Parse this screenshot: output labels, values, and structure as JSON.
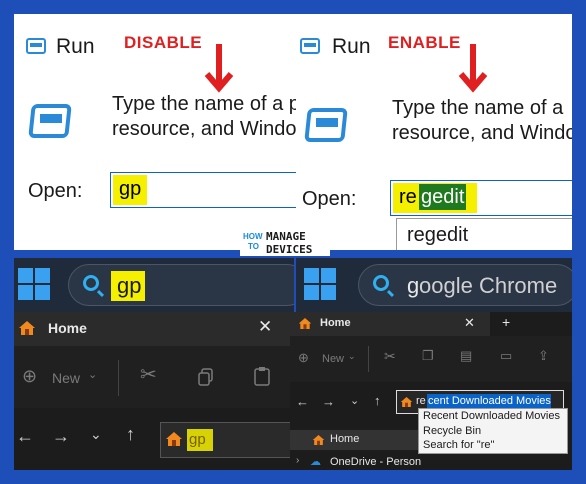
{
  "left_run": {
    "title": "Run",
    "tag": "DISABLE",
    "desc_line1": "Type the name of a pr",
    "desc_line2": "resource, and Window",
    "open_label": "Open:",
    "open_value": "gp"
  },
  "right_run": {
    "title": "Run",
    "tag": "ENABLE",
    "desc_line1": "Type the name of a",
    "desc_line2": "resource, and Windo",
    "open_label": "Open:",
    "open_value_typed": "re",
    "open_value_suggested": "gedit",
    "suggestion": "regedit"
  },
  "logo": {
    "line1a": "HOW",
    "line1b": "TO",
    "line2": "MANAGE",
    "line3": "DEVICES"
  },
  "left_taskbar": {
    "search_text": "gp"
  },
  "right_taskbar": {
    "search_typed": "g",
    "search_suggested": "oogle Chrome"
  },
  "left_explorer": {
    "tab_title": "Home",
    "close_glyph": "✕",
    "new_label": "New",
    "address_text": "gp"
  },
  "right_explorer": {
    "tab_title": "Home",
    "close_glyph": "✕",
    "plus_glyph": "+",
    "new_label": "New",
    "address_typed": "re",
    "address_selected": "cent Downloaded Movies",
    "menu_items": [
      "Recent Downloaded Movies",
      "Recycle Bin",
      "Search for \"re\""
    ],
    "nav_items": [
      "Home",
      "OneDrive - Person"
    ]
  },
  "colors": {
    "frame": "#1e4fb8",
    "highlight": "#f5f000",
    "tag_red": "#e02020",
    "selection_blue": "#0a64c8"
  }
}
